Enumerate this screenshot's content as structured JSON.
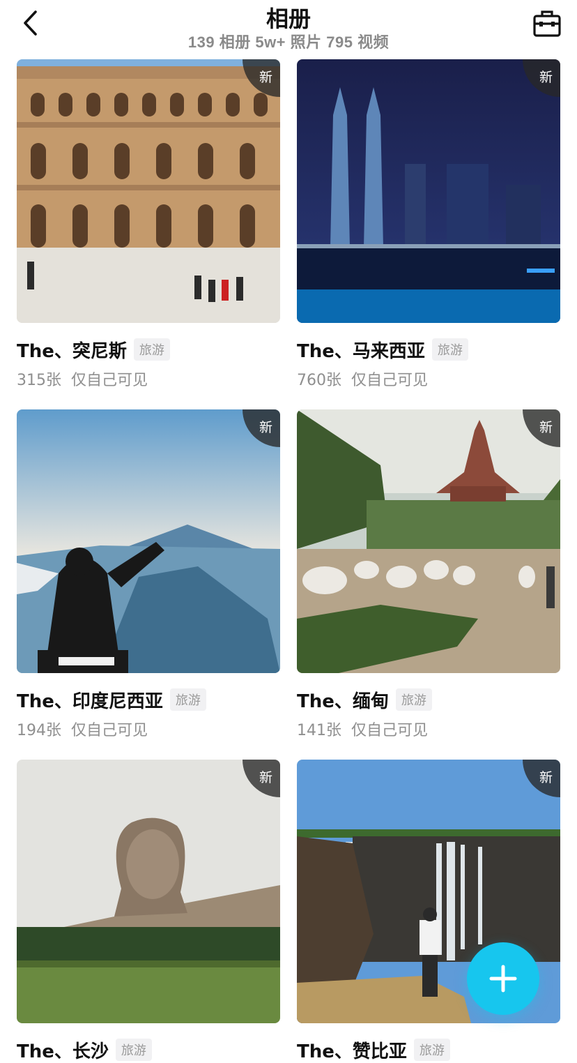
{
  "header": {
    "title": "相册",
    "subtitle": "139 相册 5w+ 照片 795 视频",
    "back_icon": "chevron-left-icon",
    "toolbox_icon": "toolbox-icon"
  },
  "albums": [
    {
      "title": "The、突尼斯",
      "tag": "旅游",
      "count": "315张",
      "visibility": "仅自己可见",
      "badge": "新"
    },
    {
      "title": "The、马来西亚",
      "tag": "旅游",
      "count": "760张",
      "visibility": "仅自己可见",
      "badge": "新"
    },
    {
      "title": "The、印度尼西亚",
      "tag": "旅游",
      "count": "194张",
      "visibility": "仅自己可见",
      "badge": "新"
    },
    {
      "title": "The、缅甸",
      "tag": "旅游",
      "count": "141张",
      "visibility": "仅自己可见",
      "badge": "新"
    },
    {
      "title": "The、长沙",
      "tag": "旅游",
      "badge": "新"
    },
    {
      "title": "The、赞比亚",
      "tag": "旅游",
      "badge": "新"
    }
  ],
  "fab": {
    "icon": "plus-icon",
    "color": "#17c6ee"
  }
}
